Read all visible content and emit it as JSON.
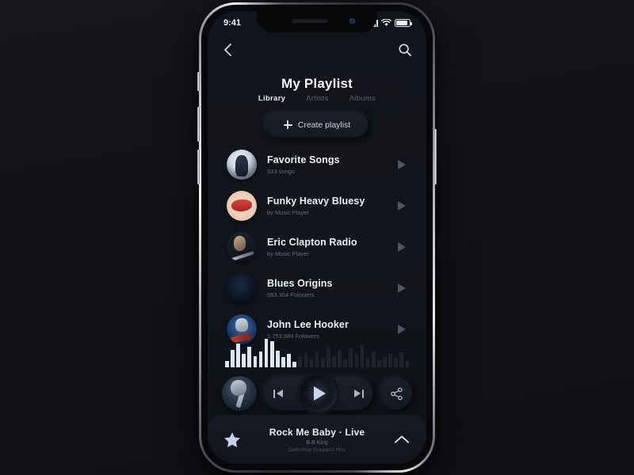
{
  "status_bar": {
    "time": "9:41",
    "signal_icon": "cellular-signal-icon",
    "wifi_icon": "wifi-icon",
    "battery_icon": "battery-icon"
  },
  "nav": {
    "back_icon": "back-chevron-icon",
    "search_icon": "search-icon"
  },
  "header": {
    "title": "My Playlist"
  },
  "tabs": [
    {
      "label": "Library",
      "active": true
    },
    {
      "label": "Artists",
      "active": false
    },
    {
      "label": "Albums",
      "active": false
    }
  ],
  "create_playlist": {
    "label": "Create playlist",
    "icon": "plus-icon"
  },
  "playlists": [
    {
      "title": "Favorite Songs",
      "subtitle": "533 songs",
      "art": "art-fav",
      "play_icon": "play-triangle-icon"
    },
    {
      "title": "Funky Heavy Bluesy",
      "subtitle": "by Music Player",
      "art": "art-funky",
      "play_icon": "play-triangle-icon"
    },
    {
      "title": "Eric Clapton Radio",
      "subtitle": "by Music Player",
      "art": "art-clapton",
      "play_icon": "play-triangle-icon"
    },
    {
      "title": "Blues Origins",
      "subtitle": "653.354 Folowers",
      "art": "art-blues",
      "play_icon": "play-triangle-icon"
    },
    {
      "title": "John Lee Hooker",
      "subtitle": "1.753.884 Folowers",
      "art": "art-hooker",
      "play_icon": "play-triangle-icon"
    }
  ],
  "waveform": {
    "played_color": "#dde4f2",
    "remaining_color": "#1e222b",
    "played_count": 13,
    "heights": [
      8,
      22,
      30,
      17,
      26,
      14,
      20,
      36,
      33,
      21,
      13,
      17,
      7,
      13,
      17,
      11,
      20,
      13,
      25,
      14,
      22,
      10,
      24,
      17,
      28,
      13,
      20,
      9,
      13,
      17,
      12,
      19,
      8
    ]
  },
  "controls": {
    "now_playing_art": "album-art-thumbnail",
    "previous_icon": "skip-previous-icon",
    "play_icon": "play-icon",
    "next_icon": "skip-next-icon",
    "share_icon": "share-icon"
  },
  "now_playing": {
    "favorite_icon": "star-icon",
    "title": "Rock Me Baby · Live",
    "artist": "B.B King",
    "album": "Definitive Greatest Hits",
    "expand_icon": "chevron-up-icon"
  },
  "colors": {
    "screen_bg": "#11141a",
    "accent_text": "#eef1f6",
    "muted_text": "#656b78",
    "play_accent": "#c9d6ef"
  }
}
